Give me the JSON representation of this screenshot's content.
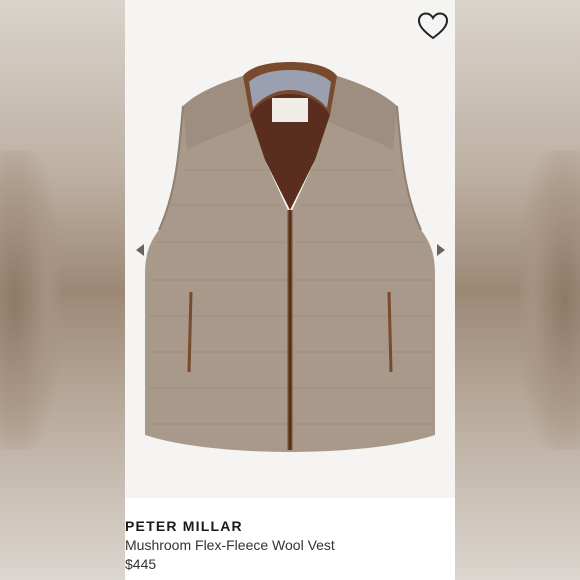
{
  "product": {
    "brand": "PETER MILLAR",
    "name": "Mushroom Flex-Fleece Wool Vest",
    "price": "$445"
  },
  "icons": {
    "favorite": "heart-outline-icon",
    "prev": "chevron-left-icon",
    "next": "chevron-right-icon"
  },
  "colors": {
    "vest_body": "#a8998a",
    "vest_trim": "#7a4a2e",
    "collar_lining": "#9aa0b0",
    "photo_bg": "#f5f4f2"
  }
}
